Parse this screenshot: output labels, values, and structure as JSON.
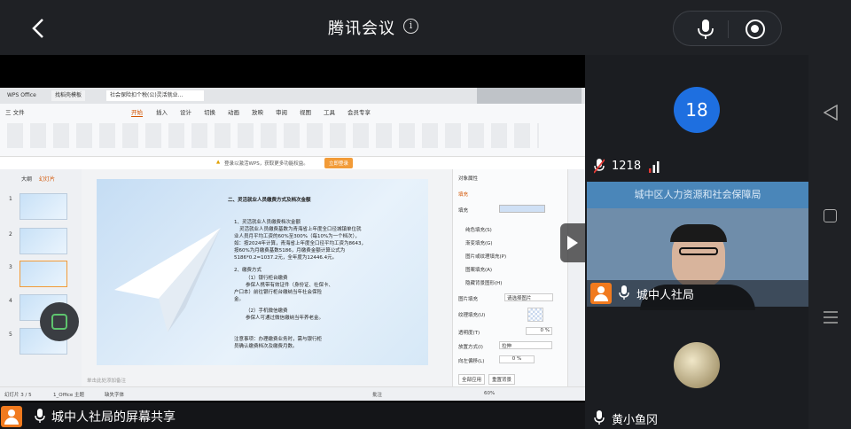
{
  "header": {
    "title": "腾讯会议",
    "info_icon": "info-icon"
  },
  "controls": {
    "mic": "mic-icon",
    "record": "record-icon"
  },
  "screen_share": {
    "presenter_label": "城中人社局的屏幕共享",
    "wps": {
      "tabs": [
        "WPS Office",
        "找稻壳模板",
        "社会保险扣个税(公)灵活就业..."
      ],
      "menu": [
        "三 文件",
        "开始",
        "插入",
        "设计",
        "切换",
        "动画",
        "放映",
        "审阅",
        "视图",
        "工具",
        "会员专享"
      ],
      "notice": "登录以激活WPS，获取更多功能权益。",
      "notice_button": "立即登录",
      "panel_tabs": [
        "大纲",
        "幻灯片"
      ],
      "slide_numbers": [
        "1",
        "2",
        "3",
        "4",
        "5"
      ],
      "slide": {
        "heading": "二、灵活就业人员缴费方式及档次金额",
        "lines": [
          "1、灵活就业人员缴费档次金额",
          "灵活就业人员缴费基数为青海省上年度全口径城镇单位就",
          "业人员月平均工资的60%至300%（每10%为一个档次），",
          "如：按2024年计算，青海省上年度全口径平均工资为8643，",
          "按60%为月缴费基数5186，月缴费金额计算公式为",
          "5186*0.2=1037.2元，全年度为12446.4元。",
          "2、缴费方式",
          "（1）银行柜台缴费",
          "参保人携带有效证件（身份证、社保卡、",
          "户口本）前往银行柜台缴纳当年社会保险",
          "金。",
          "（2）手机微信缴费",
          "参保人可通过微信缴纳当年养老金。",
          "注意事项：办理缴费业务时，需与银行柜",
          "员确认缴费档次及缴费月数。"
        ]
      },
      "notes_placeholder": "单击此处添加备注",
      "pane": {
        "title": "对象属性",
        "tab": "填充",
        "section": "填充",
        "options": [
          "纯色填充(S)",
          "渐变填充(G)",
          "图片或纹理填充(P)",
          "图案填充(A)",
          "隐藏背景图形(H)"
        ],
        "fields": [
          "图片填充",
          "纹理填充(U)",
          "透明度(T)",
          "放置方式(I)",
          "向左偏移(L)"
        ],
        "field_values": [
          "请选择图片",
          "",
          "0 %",
          "拉伸",
          "0 %"
        ],
        "buttons": [
          "全部应用",
          "重置背景"
        ]
      },
      "status": {
        "slide_counter": "幻灯片 3 / 5",
        "theme": "1_Office 主题",
        "font_missing": "缺失字体",
        "zoom": "60%",
        "notes": "备注",
        "comments": "批注"
      }
    }
  },
  "participants": [
    {
      "count_badge": "18",
      "name": "1218"
    },
    {
      "name": "城中人社局",
      "banner": "城中区人力资源和社会保障局"
    },
    {
      "name": "黄小鱼冈"
    }
  ]
}
